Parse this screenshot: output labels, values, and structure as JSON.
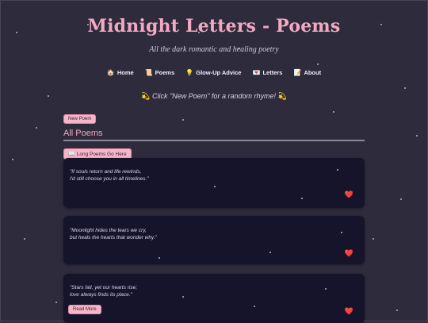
{
  "header": {
    "title": "Midnight Letters - Poems",
    "subtitle": "All the dark romantic and healing poetry"
  },
  "nav": [
    {
      "icon": "🏠",
      "icon_name": "home-icon",
      "label": "Home"
    },
    {
      "icon": "📜",
      "icon_name": "scroll-icon",
      "label": "Poems"
    },
    {
      "icon": "💡",
      "icon_name": "lightbulb-icon",
      "label": "Glow-Up Advice"
    },
    {
      "icon": "💌",
      "icon_name": "love-letter-icon",
      "label": "Letters"
    },
    {
      "icon": "📝",
      "icon_name": "memo-icon",
      "label": "About"
    }
  ],
  "hint": {
    "icon": "💫",
    "text": "Click \"New Poem\" for a random rhyme!"
  },
  "buttons": {
    "new_poem": "New Poem",
    "long_poems_icon": "📖",
    "long_poems": "Long Poems Go Here",
    "read_more": "Read More"
  },
  "section": {
    "title": "All Poems"
  },
  "poems": [
    {
      "text": "\"If souls return and life rewinds,\nI'd still choose you in all timelines.\""
    },
    {
      "text": "\"Moonlight hides the tears we cry,\nbut heals the hearts that wonder why.\""
    },
    {
      "text": "\"Stars fall, yet our hearts rise;\nlove always finds its place.\""
    }
  ],
  "heart_icon": "❤️",
  "colors": {
    "background": "#2e2b3c",
    "title_pink": "#f2a9c2",
    "card_bg": "#15142b",
    "button_pink": "#f7b6c8",
    "heart_red": "#e23b4d"
  }
}
